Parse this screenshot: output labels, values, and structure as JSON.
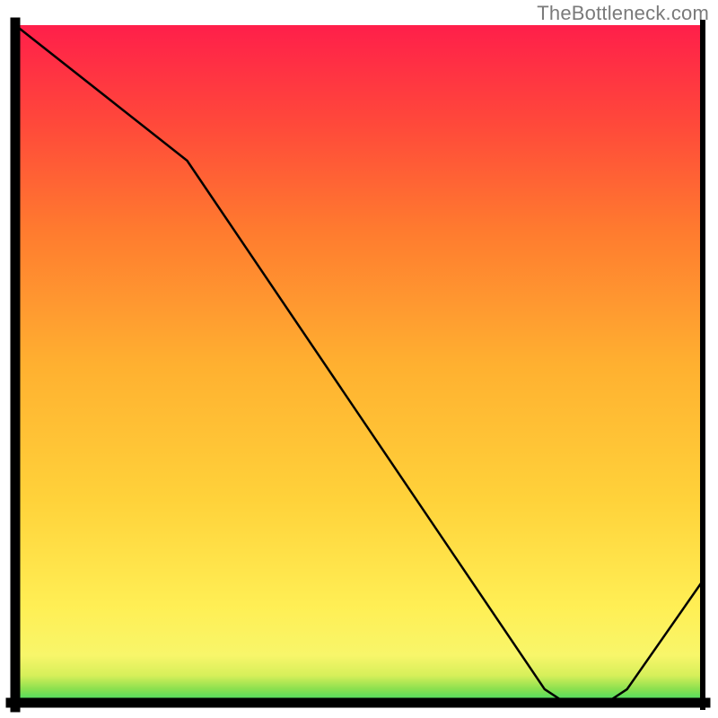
{
  "attribution": "TheBottleneck.com",
  "chart_data": {
    "type": "line",
    "title": "",
    "xlabel": "",
    "ylabel": "",
    "xlim": [
      0,
      100
    ],
    "ylim": [
      0,
      100
    ],
    "grid": false,
    "series": [
      {
        "name": "curve",
        "x": [
          0,
          25,
          77,
          80,
          86,
          89,
          100
        ],
        "y": [
          100,
          80,
          2,
          0,
          0,
          2,
          18
        ]
      }
    ],
    "marker": {
      "name": "optimum-band",
      "x_start": 77,
      "x_end": 89,
      "y": 0.5
    },
    "background_gradient": {
      "stops": [
        {
          "offset": 0.0,
          "color": "#3ddc66"
        },
        {
          "offset": 0.02,
          "color": "#8ae04f"
        },
        {
          "offset": 0.04,
          "color": "#d6ef5a"
        },
        {
          "offset": 0.07,
          "color": "#f8f66a"
        },
        {
          "offset": 0.14,
          "color": "#ffef55"
        },
        {
          "offset": 0.3,
          "color": "#ffd23a"
        },
        {
          "offset": 0.5,
          "color": "#ffb030"
        },
        {
          "offset": 0.7,
          "color": "#ff7a2f"
        },
        {
          "offset": 0.85,
          "color": "#ff4a3a"
        },
        {
          "offset": 1.0,
          "color": "#ff1f4a"
        }
      ]
    }
  }
}
